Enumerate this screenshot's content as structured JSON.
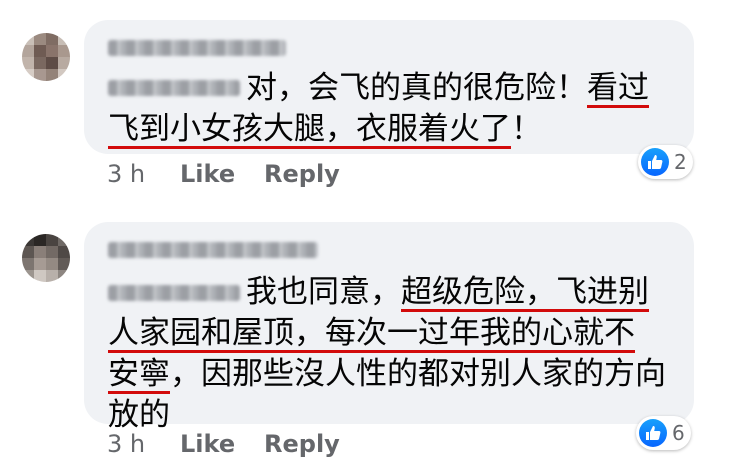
{
  "colors": {
    "underline": "#d20b0b",
    "bubble": "#f0f2f5",
    "meta": "#65676b",
    "like_blue": "#0866ff"
  },
  "comments": [
    {
      "avatar_icon": "pixelated-avatar-icon",
      "text_plain_1": "对，会飞的真的很危险！",
      "text_under_1": "看过",
      "text_under_2": "飞到小女孩大腿，衣服着火了",
      "text_plain_2": "！",
      "time": "3 h",
      "like_label": "Like",
      "reply_label": "Reply",
      "reaction_icon": "thumbs-up-icon",
      "reaction_count": "2"
    },
    {
      "avatar_icon": "pixelated-avatar-icon",
      "text_plain_1": "我也同意，",
      "text_under_1": "超级危险，飞进别",
      "text_under_2": "人家园和屋顶，每次一过年我的心就不",
      "text_under_3": "安寧",
      "text_plain_2": "，因那些沒人性的都对别人家的方向放的",
      "time": "3 h",
      "like_label": "Like",
      "reply_label": "Reply",
      "reaction_icon": "thumbs-up-icon",
      "reaction_count": "6"
    }
  ]
}
